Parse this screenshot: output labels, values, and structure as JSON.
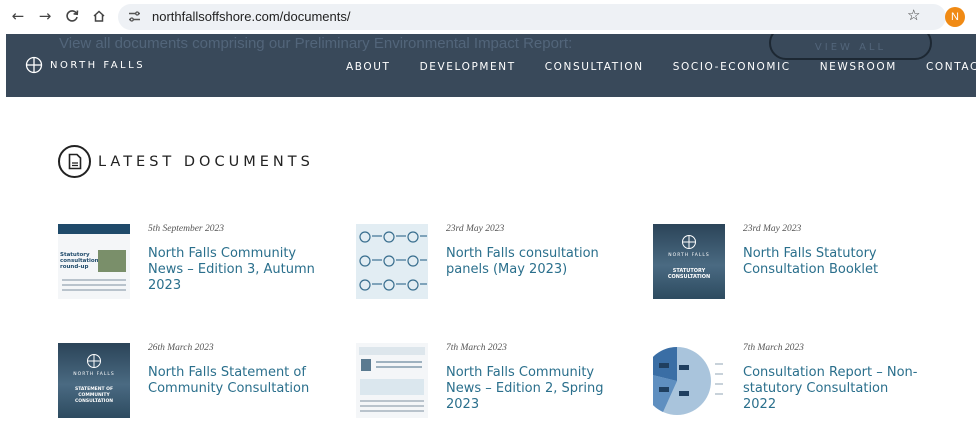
{
  "browser": {
    "url": "northfallsoffshore.com/documents/",
    "profile_initial": "N"
  },
  "promo": {
    "text": "View all documents comprising our Preliminary Environmental Impact Report:",
    "button_label": "VIEW ALL"
  },
  "header": {
    "logo_text": "NORTH FALLS",
    "nav": [
      "ABOUT",
      "DEVELOPMENT",
      "CONSULTATION",
      "SOCIO-ECONOMIC",
      "NEWSROOM",
      "CONTACT"
    ]
  },
  "section": {
    "title": "LATEST DOCUMENTS"
  },
  "documents": [
    {
      "date": "5th September 2023",
      "title": "North Falls Community News – Edition 3, Autumn 2023",
      "thumb_text": "Statutory consultation round-up"
    },
    {
      "date": "23rd May 2023",
      "title": "North Falls consultation panels (May 2023)"
    },
    {
      "date": "23rd May 2023",
      "title": "North Falls Statutory Consultation Booklet",
      "thumb_text": "STATUTORY CONSULTATION",
      "thumb_logo": "NORTH FALLS"
    },
    {
      "date": "26th March 2023",
      "title": "North Falls Statement of Community Consultation",
      "thumb_text": "STATEMENT OF COMMUNITY CONSULTATION",
      "thumb_logo": "NORTH FALLS"
    },
    {
      "date": "7th March 2023",
      "title": "North Falls Community News – Edition 2, Spring 2023"
    },
    {
      "date": "7th March 2023",
      "title": "Consultation Report – Non-statutory Consultation 2022"
    }
  ],
  "colors": {
    "header_bg": "#39495a",
    "link": "#2a6f8c",
    "profile": "#f08a14"
  }
}
